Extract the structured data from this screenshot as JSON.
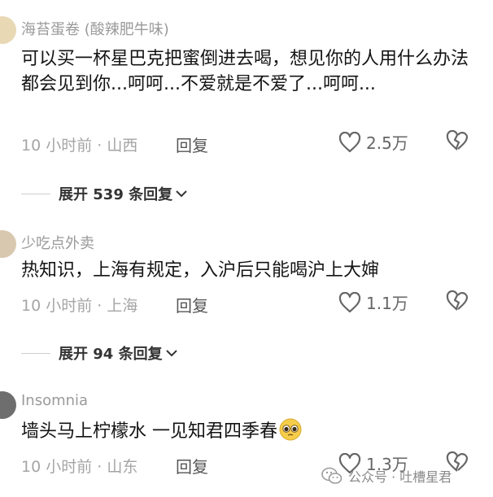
{
  "comments": [
    {
      "username": "海苔蛋卷 (酸辣肥牛味)",
      "avatar_color": "#e8d8b4",
      "text": "可以买一杯星巴克把蜜倒进去喝，想见你的人用什么办法都会见到你...呵呵...不爱就是不爱了...呵呵...",
      "time": "10 小时前 · 山西",
      "reply_label": "回复",
      "likes": "2.5万",
      "expand_label": "展开 539 条回复"
    },
    {
      "username": "少吃点外卖",
      "avatar_color": "#d9c8b0",
      "text": "热知识，上海有规定，入沪后只能喝沪上大婶",
      "time": "10 小时前 · 上海",
      "reply_label": "回复",
      "likes": "1.1万",
      "expand_label": "展开 94 条回复"
    },
    {
      "username": "Insomnia",
      "avatar_color": "#6e6e6e",
      "text": "墙头马上柠檬水 一见知君四季春",
      "time": "10 小时前 · 山东",
      "reply_label": "回复",
      "likes": "1.3万"
    }
  ],
  "watermark": {
    "text": "公众号 · 吐槽星君",
    "icon": "wechat-icon"
  },
  "colors": {
    "username": "#9a9a9a",
    "meta": "#a5a5a5",
    "text": "#141414"
  }
}
